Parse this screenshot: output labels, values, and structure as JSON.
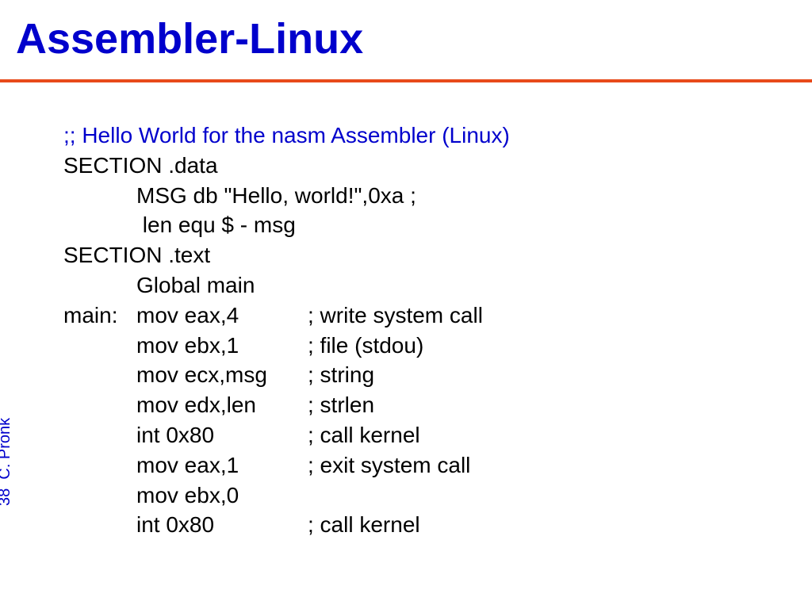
{
  "title": "Assembler-Linux",
  "comment_header": ";; Hello World for the nasm Assembler (Linux)",
  "lines": {
    "section_data": "SECTION .data",
    "msg": "MSG db \"Hello, world!\",0xa ;",
    "len": " len equ $ - msg",
    "section_text": "SECTION .text",
    "global_main": "Global main",
    "main_label": "main:",
    "mov_eax4": "mov eax,4",
    "mov_eax4_c": "; write system call",
    "mov_ebx1": "mov ebx,1",
    "mov_ebx1_c": "; file (stdou)",
    "mov_ecx": "mov ecx,msg",
    "mov_ecx_c": "; string",
    "mov_edx": "mov edx,len",
    "mov_edx_c": "; strlen",
    "int80a": "int 0x80",
    "int80a_c": "; call kernel",
    "mov_eax1": "mov eax,1",
    "mov_eax1_c": "; exit system call",
    "mov_ebx0": "mov ebx,0",
    "int80b": "int 0x80",
    "int80b_c": "; call kernel"
  },
  "page_number": "38",
  "author": "C. Pronk"
}
